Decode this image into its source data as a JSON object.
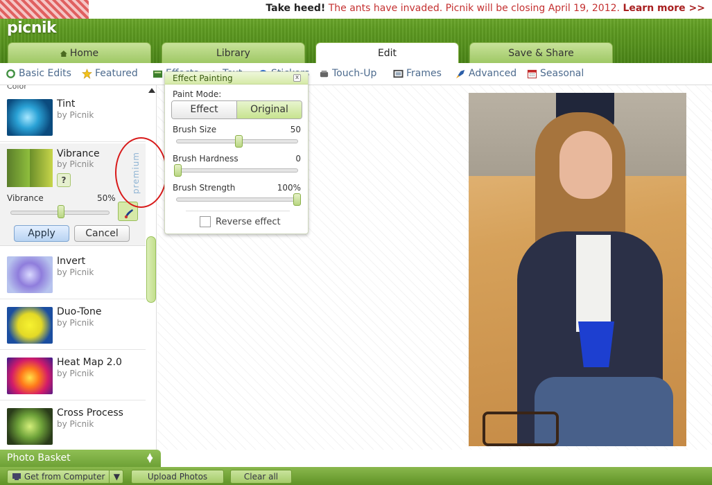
{
  "announcement": {
    "heading": "Take heed!",
    "message": "The ants have invaded. Picnik will be closing April 19, 2012.",
    "link": "Learn more >>"
  },
  "logo": "picnik",
  "main_tabs": [
    {
      "label": "Home",
      "icon": "home-icon"
    },
    {
      "label": "Library"
    },
    {
      "label": "Edit",
      "active": true
    },
    {
      "label": "Save & Share"
    }
  ],
  "sub_tabs": [
    {
      "label": "Basic Edits",
      "icon": "refresh-icon"
    },
    {
      "label": "Featured",
      "icon": "star-icon"
    },
    {
      "label": "Effects",
      "icon": "effects-icon"
    },
    {
      "label": "Text",
      "icon": "text-icon"
    },
    {
      "label": "Stickers",
      "icon": "sticker-icon"
    },
    {
      "label": "Touch-Up",
      "icon": "touchup-icon"
    },
    {
      "label": "Frames",
      "icon": "frame-icon"
    },
    {
      "label": "Advanced",
      "icon": "rocket-icon"
    },
    {
      "label": "Seasonal",
      "icon": "calendar-icon"
    }
  ],
  "sidebar": {
    "section": "Color",
    "effects": [
      {
        "name": "Tint",
        "by": "by Picnik"
      },
      {
        "name": "Vibrance",
        "by": "by Picnik"
      },
      {
        "name": "Invert",
        "by": "by Picnik"
      },
      {
        "name": "Duo-Tone",
        "by": "by Picnik"
      },
      {
        "name": "Heat Map 2.0",
        "by": "by Picnik"
      },
      {
        "name": "Cross Process",
        "by": "by Picnik"
      }
    ],
    "vibrance_panel": {
      "help": "?",
      "premium": "premium",
      "slider_label": "Vibrance",
      "slider_value": "50%",
      "slider_fraction": 0.5,
      "apply": "Apply",
      "cancel": "Cancel"
    }
  },
  "effect_painting": {
    "title": "Effect Painting",
    "close": "x",
    "paint_mode_label": "Paint Mode:",
    "mode_effect": "Effect",
    "mode_original": "Original",
    "selected_mode": "Original",
    "brush_size": {
      "label": "Brush Size",
      "value": "50",
      "fraction": 0.5
    },
    "brush_hardness": {
      "label": "Brush Hardness",
      "value": "0",
      "fraction": 0.0
    },
    "brush_strength": {
      "label": "Brush Strength",
      "value": "100%",
      "fraction": 1.0
    },
    "reverse_label": "Reverse effect",
    "reverse_checked": false
  },
  "photo_basket": {
    "label": "Photo Basket",
    "buttons": [
      "Get from Computer",
      "Upload Photos",
      "Clear all"
    ]
  },
  "colors": {
    "accent_green": "#7fb83c",
    "alert_red": "#c43030",
    "annotation_circle": "#d81a1a"
  }
}
